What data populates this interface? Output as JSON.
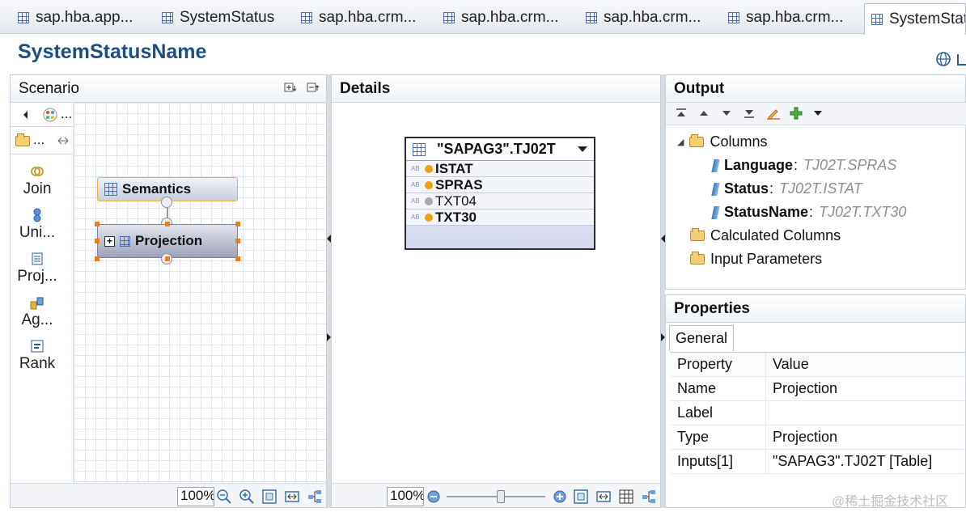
{
  "tabs": [
    {
      "label": "sap.hba.app...",
      "active": false
    },
    {
      "label": "SystemStatus",
      "active": false
    },
    {
      "label": "sap.hba.crm...",
      "active": false
    },
    {
      "label": "sap.hba.crm...",
      "active": false
    },
    {
      "label": "sap.hba.crm...",
      "active": false
    },
    {
      "label": "sap.hba.crm...",
      "active": false
    },
    {
      "label": "SystemStatu",
      "active": true
    }
  ],
  "editor": {
    "title": "SystemStatusName"
  },
  "scenario": {
    "title": "Scenario",
    "palette": {
      "truncated_label": "...",
      "items": [
        {
          "label": "Join",
          "icon": "join-icon"
        },
        {
          "label": "Uni...",
          "icon": "union-icon"
        },
        {
          "label": "Proj...",
          "icon": "projection-icon"
        },
        {
          "label": "Ag...",
          "icon": "aggregation-icon"
        },
        {
          "label": "Rank",
          "icon": "rank-icon"
        }
      ]
    },
    "nodes": {
      "semantics": "Semantics",
      "projection": "Projection",
      "expand": "+"
    },
    "zoom": "100%"
  },
  "details": {
    "title": "Details",
    "table": {
      "name": "\"SAPAG3\".TJ02T",
      "columns": [
        {
          "name": "ISTAT",
          "type_tag": "AB",
          "selected": true
        },
        {
          "name": "SPRAS",
          "type_tag": "AB",
          "selected": true
        },
        {
          "name": "TXT04",
          "type_tag": "AB",
          "selected": false
        },
        {
          "name": "TXT30",
          "type_tag": "AB",
          "selected": true
        }
      ]
    },
    "zoom": "100%"
  },
  "output": {
    "title": "Output",
    "tree": {
      "columns_label": "Columns",
      "columns": [
        {
          "name": "Language",
          "source": "TJ02T.SPRAS"
        },
        {
          "name": "Status",
          "source": "TJ02T.ISTAT"
        },
        {
          "name": "StatusName",
          "source": "TJ02T.TXT30"
        }
      ],
      "calculated_label": "Calculated Columns",
      "input_params_label": "Input Parameters"
    }
  },
  "properties": {
    "title": "Properties",
    "tab": "General",
    "header": {
      "key": "Property",
      "value": "Value"
    },
    "rows": [
      {
        "key": "Name",
        "value": "Projection"
      },
      {
        "key": "Label",
        "value": ""
      },
      {
        "key": "Type",
        "value": "Projection"
      },
      {
        "key": "Inputs[1]",
        "value": "\"SAPAG3\".TJ02T [Table]"
      }
    ]
  },
  "colors": {
    "title": "#1d4e80",
    "selected_dot": "#f39c12",
    "unselected_dot": "#a9a9a9",
    "handle": "#f07c1a"
  },
  "watermark": "@稀土掘金技术社区"
}
